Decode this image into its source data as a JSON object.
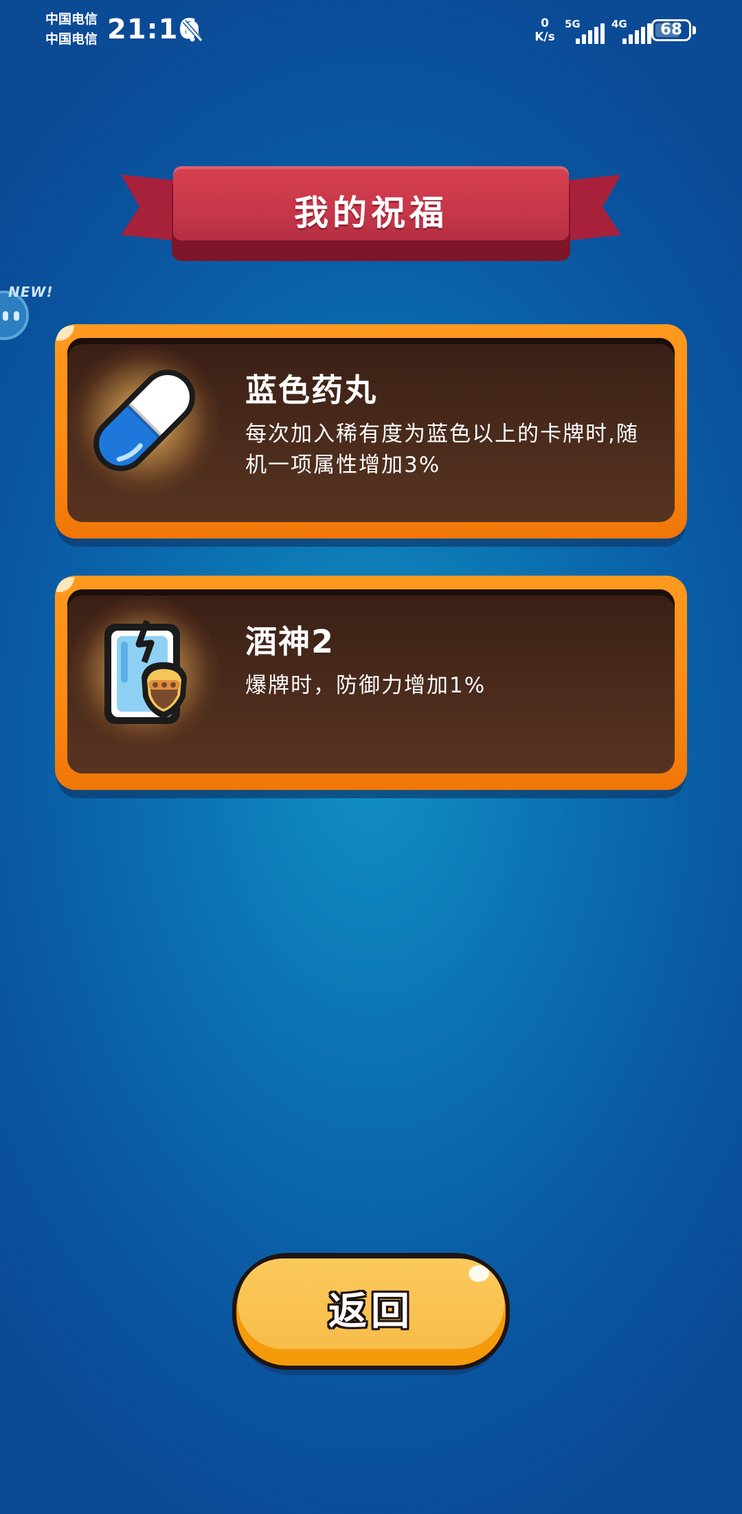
{
  "status_bar": {
    "carrier_1": "中国电信",
    "carrier_2": "中国电信",
    "time": "21:16",
    "net_speed_value": "0",
    "net_speed_unit": "K/s",
    "signal_1_label": "5G",
    "signal_2_label": "4G",
    "battery_level": "68"
  },
  "banner": {
    "title": "我的祝福"
  },
  "edge_badge": {
    "label": "NEW!"
  },
  "blessings": [
    {
      "name": "蓝色药丸",
      "description": "每次加入稀有度为蓝色以上的卡牌时,随机一项属性增加3%",
      "icon": "blue-pill-icon"
    },
    {
      "name": "酒神2",
      "description": "爆牌时，防御力增加1%",
      "icon": "card-shield-icon"
    }
  ],
  "back_button": {
    "label": "返回"
  },
  "colors": {
    "background": "#0b6fb0",
    "banner_red": "#c7374a",
    "card_frame_orange": "#ff8a12",
    "card_inner_brown": "#4a2b1c",
    "button_yellow": "#f8bd4a"
  }
}
